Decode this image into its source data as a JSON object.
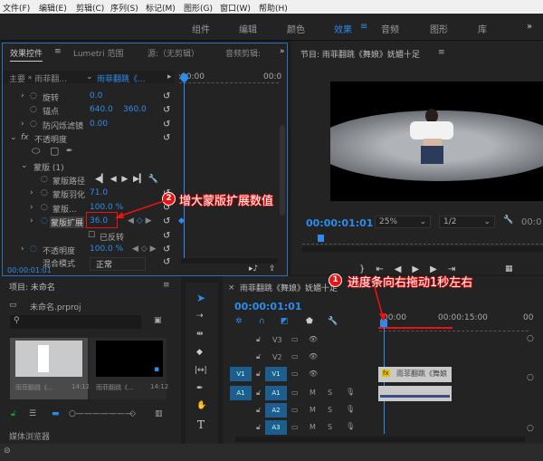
{
  "menu": [
    "文件(F)",
    "编辑(E)",
    "剪辑(C)",
    "序列(S)",
    "标记(M)",
    "图形(G)",
    "窗口(W)",
    "帮助(H)"
  ],
  "workspaces": [
    "组件",
    "编辑",
    "颜色",
    "效果",
    "音频",
    "图形",
    "库"
  ],
  "workspace_active": "效果",
  "more": "»",
  "effect_controls": {
    "tabs": [
      "效果控件",
      "Lumetri 范围",
      "源:（无剪辑）",
      "音频剪辑:"
    ],
    "master": "主要 * 雨菲翻...",
    "clip": "雨菲翻跳《...",
    "ruler_start": ":00:00",
    "ruler_end": "00:0",
    "props": [
      {
        "name": "旋转",
        "v1": "0.0"
      },
      {
        "name": "锚点",
        "v1": "640.0",
        "v2": "360.0"
      },
      {
        "name": "防闪烁滤镜",
        "v1": "0.00"
      }
    ],
    "opacity_section": "不透明度",
    "mask": "蒙版 (1)",
    "mask_path": "蒙版路径",
    "mask_feather": {
      "name": "蒙版羽化",
      "value": "71.0"
    },
    "mask_opacity": {
      "name": "蒙版...",
      "value": "100.0 %"
    },
    "mask_expansion": {
      "name": "蒙版扩展",
      "value": "36.0"
    },
    "inverted": "已反转",
    "opacity": {
      "name": "不透明度",
      "value": "100.0 %"
    },
    "blend": {
      "name": "混合模式",
      "value": "正常"
    },
    "timecode": "00:00:01:01"
  },
  "program": {
    "title": "节目: 雨菲翻跳《舞娘》妩媚十足",
    "timecode": "00:00:01:01",
    "zoom": "25%",
    "resolution": "1/2",
    "duration": "00:0"
  },
  "project": {
    "title": "项目: 未命名",
    "file": "未命名.prproj",
    "search_placeholder": "",
    "items": [
      {
        "name": "雨菲翻跳《...",
        "duration": "14:12"
      },
      {
        "name": "雨菲翻跳《...",
        "duration": "14:12"
      }
    ],
    "media_browser": "媒体浏览器"
  },
  "timeline": {
    "title": "雨菲翻跳《舞娘》妩媚十足",
    "timecode": "00:00:01:01",
    "ruler": [
      ":00:00",
      "00:00:15:00",
      "00"
    ],
    "video_tracks": [
      "V3",
      "V2",
      "V1"
    ],
    "audio_tracks": [
      "A1",
      "A2",
      "A3"
    ],
    "source_v": "V1",
    "source_a": "A1",
    "clip_label": "雨菲翻跳《舞娘",
    "m": "M",
    "s": "S"
  },
  "annotations": [
    {
      "num": "1",
      "text": "进度条向右拖动1秒左右"
    },
    {
      "num": "2",
      "text": "增大蒙版扩展数值"
    }
  ],
  "colors": {
    "accent": "#2d8ceb",
    "annotation": "#e11111",
    "track": "#1d5e8f"
  }
}
